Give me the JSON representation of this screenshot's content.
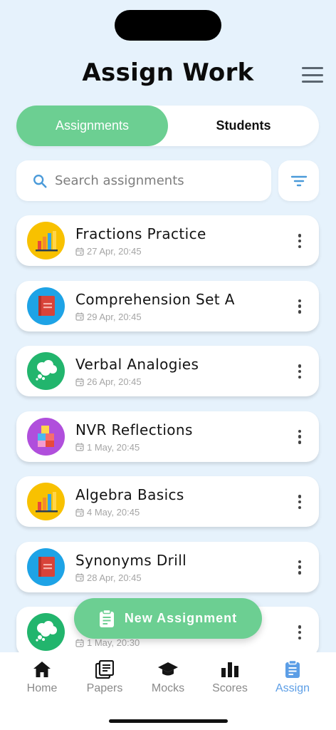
{
  "header": {
    "title": "Assign Work"
  },
  "segments": {
    "assignments": "Assignments",
    "students": "Students"
  },
  "search": {
    "placeholder": "Search assignments"
  },
  "assignments": [
    {
      "title": "Fractions Practice",
      "date": "27 Apr, 20:45",
      "icon": "bar-chart-icon",
      "color": "#f8c100"
    },
    {
      "title": "Comprehension Set A",
      "date": "29 Apr, 20:45",
      "icon": "book-icon",
      "color": "#1ea3e6"
    },
    {
      "title": "Verbal Analogies",
      "date": "26 Apr, 20:45",
      "icon": "thought-bubble-icon",
      "color": "#22b56d"
    },
    {
      "title": "NVR Reflections",
      "date": "1 May, 20:45",
      "icon": "blocks-icon",
      "color": "#b04fdc"
    },
    {
      "title": "Algebra Basics",
      "date": "4 May, 20:45",
      "icon": "bar-chart-icon",
      "color": "#f8c100"
    },
    {
      "title": "Synonyms Drill",
      "date": "28 Apr, 20:45",
      "icon": "book-icon",
      "color": "#1ea3e6"
    },
    {
      "title": "",
      "date": "1 May, 20:30",
      "icon": "thought-bubble-icon",
      "color": "#22b56d"
    }
  ],
  "fab": {
    "label": "New Assignment"
  },
  "tabs": [
    {
      "label": "Home",
      "icon": "home-icon"
    },
    {
      "label": "Papers",
      "icon": "papers-icon"
    },
    {
      "label": "Mocks",
      "icon": "graduation-cap-icon"
    },
    {
      "label": "Scores",
      "icon": "scores-icon"
    },
    {
      "label": "Assign",
      "icon": "clipboard-icon"
    }
  ],
  "colors": {
    "accent": "#6ccf92",
    "active_tab": "#5c9ee6",
    "background": "#e6f2fc"
  }
}
